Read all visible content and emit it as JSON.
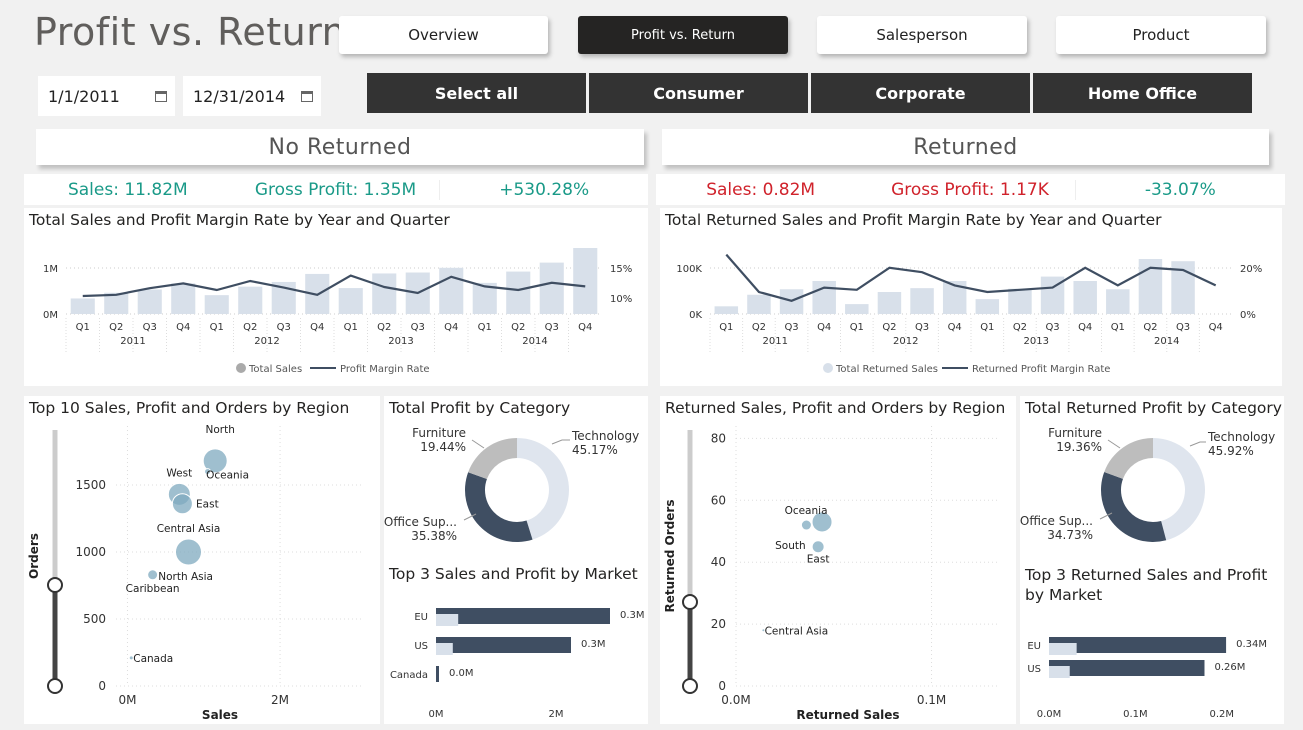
{
  "page_title": "Profit vs. Return",
  "nav": [
    "Overview",
    "Profit vs. Return",
    "Salesperson",
    "Product"
  ],
  "dates": {
    "start": "1/1/2011",
    "end": "12/31/2014"
  },
  "segments": [
    "Select all",
    "Consumer",
    "Corporate",
    "Home Office"
  ],
  "left": {
    "header": "No Returned",
    "kpi": {
      "sales": "Sales: 11.82M",
      "profit": "Gross Profit: 1.35M",
      "change": "+530.28%"
    },
    "combo_title": "Total Sales and Profit Margin Rate by Year and Quarter",
    "scatter_title": "Top 10 Sales, Profit and Orders by Region",
    "donut_title": "Total Profit by Category",
    "bar_title": "Top 3 Sales and Profit by Market"
  },
  "right": {
    "header": "Returned",
    "kpi": {
      "sales": "Sales: 0.82M",
      "profit": "Gross Profit: 1.17K",
      "change": "-33.07%"
    },
    "combo_title": "Total Returned Sales and Profit Margin Rate by Year and Quarter",
    "scatter_title": "Returned Sales, Profit and Orders by Region",
    "donut_title": "Total Returned Profit by Category",
    "bar_title": "Top 3 Returned Sales and Profit by Market"
  },
  "colors": {
    "green": "#1a9a88",
    "red": "#d0222b",
    "bar_light": "#d8e0ea",
    "line_dark": "#3f4e62",
    "bubble": "#7fa9bf",
    "grey_slice": "#bdbdbd"
  },
  "chart_data": [
    {
      "type": "bar",
      "id": "combo_left",
      "quarters": [
        "Q1",
        "Q2",
        "Q3",
        "Q4",
        "Q1",
        "Q2",
        "Q3",
        "Q4",
        "Q1",
        "Q2",
        "Q3",
        "Q4",
        "Q1",
        "Q2",
        "Q3",
        "Q4"
      ],
      "years": [
        "2011",
        "2012",
        "2013",
        "2014"
      ],
      "y_ticks": [
        "1M",
        "0M"
      ],
      "y2_ticks": [
        "15%",
        "10%"
      ],
      "series": [
        {
          "name": "Total Sales",
          "values": [
            0.33,
            0.45,
            0.52,
            0.65,
            0.4,
            0.58,
            0.68,
            0.85,
            0.55,
            0.86,
            0.88,
            0.98,
            0.66,
            0.9,
            1.09,
            1.4
          ]
        },
        {
          "name": "Profit Margin Rate",
          "values": [
            10.0,
            10.2,
            11.3,
            12.1,
            11.0,
            12.5,
            11.4,
            10.2,
            13.4,
            11.5,
            10.5,
            13.2,
            11.6,
            11.0,
            12.2,
            11.6
          ]
        }
      ],
      "ylim": [
        0,
        1.4
      ],
      "y2lim": [
        7,
        18
      ]
    },
    {
      "type": "bar",
      "id": "combo_right",
      "quarters": [
        "Q1",
        "Q2",
        "Q3",
        "Q4",
        "Q1",
        "Q2",
        "Q3",
        "Q4",
        "Q1",
        "Q2",
        "Q3",
        "Q4",
        "Q1",
        "Q2",
        "Q3",
        "Q4"
      ],
      "years": [
        "2011",
        "2012",
        "2013",
        "2014"
      ],
      "y_ticks": [
        "100K",
        "0K"
      ],
      "y2_ticks": [
        "20%",
        "0%"
      ],
      "series": [
        {
          "name": "Total Returned Sales",
          "values": [
            14,
            35,
            45,
            60,
            18,
            40,
            47,
            60,
            27,
            46,
            68,
            60,
            45,
            100,
            96
          ]
        },
        {
          "name": "Returned Profit Margin Rate",
          "values": [
            27,
            10,
            6,
            12,
            11,
            21,
            19,
            13,
            10,
            11,
            12,
            21,
            13,
            21,
            20,
            13
          ]
        }
      ],
      "ylim": [
        0,
        120
      ],
      "y2lim": [
        0,
        30
      ]
    },
    {
      "type": "scatter",
      "id": "scatter_left",
      "xlabel": "Sales",
      "ylabel": "Orders",
      "x_ticks": [
        "0M",
        "2M"
      ],
      "y_ticks": [
        "0",
        "500",
        "1000",
        "1500"
      ],
      "points": [
        {
          "label": "North",
          "x": 1.15,
          "y": 1680,
          "r": 12
        },
        {
          "label": "West",
          "x": 0.68,
          "y": 1430,
          "r": 11
        },
        {
          "label": "Oceania",
          "x": 1.05,
          "y": 1600,
          "r": 3
        },
        {
          "label": "East",
          "x": 0.72,
          "y": 1360,
          "r": 10
        },
        {
          "label": "Central Asia",
          "x": 0.8,
          "y": 1000,
          "r": 13
        },
        {
          "label": "North Asia",
          "x": 0.33,
          "y": 830,
          "r": 5
        },
        {
          "label": "Caribbean",
          "x": 0.33,
          "y": 830,
          "r": 0
        },
        {
          "label": "Canada",
          "x": 0.05,
          "y": 210,
          "r": 2
        }
      ]
    },
    {
      "type": "scatter",
      "id": "scatter_right",
      "xlabel": "Returned Sales",
      "ylabel": "Returned Orders",
      "x_ticks": [
        "0.0M",
        "0.1M"
      ],
      "y_ticks": [
        "0",
        "20",
        "40",
        "60",
        "80"
      ],
      "points": [
        {
          "label": "Oceania",
          "x": 0.044,
          "y": 53,
          "r": 10
        },
        {
          "label": "South",
          "x": 0.036,
          "y": 52,
          "r": 5
        },
        {
          "label": "East",
          "x": 0.042,
          "y": 45,
          "r": 6
        },
        {
          "label": "Central Asia",
          "x": 0.014,
          "y": 18,
          "r": 1.5
        }
      ]
    },
    {
      "type": "pie",
      "id": "donut_left",
      "slices": [
        {
          "label": "Technology",
          "pct": "45.17%",
          "value": 45.17
        },
        {
          "label": "Office Sup...",
          "pct": "35.38%",
          "value": 35.38
        },
        {
          "label": "Furniture",
          "pct": "19.44%",
          "value": 19.44
        }
      ]
    },
    {
      "type": "pie",
      "id": "donut_right",
      "slices": [
        {
          "label": "Technology",
          "pct": "45.92%",
          "value": 45.92
        },
        {
          "label": "Office Sup...",
          "pct": "34.73%",
          "value": 34.73
        },
        {
          "label": "Furniture",
          "pct": "19.36%",
          "value": 19.36
        }
      ]
    },
    {
      "type": "bar",
      "id": "market_left",
      "categories": [
        "EU",
        "US",
        "Canada"
      ],
      "x_ticks": [
        "0M",
        "2M"
      ],
      "series": [
        {
          "name": "Sales",
          "values": [
            2.9,
            2.25,
            0.03
          ]
        },
        {
          "name": "Profit",
          "values": [
            0.37,
            0.28,
            0.0
          ]
        }
      ],
      "labels": [
        "0.3M",
        "0.3M",
        "0.0M"
      ],
      "xlim": [
        0,
        3.0
      ]
    },
    {
      "type": "bar",
      "id": "market_right",
      "categories": [
        "EU",
        "US"
      ],
      "x_ticks": [
        "0.0M",
        "0.1M",
        "0.2M"
      ],
      "series": [
        {
          "name": "Sales",
          "values": [
            0.205,
            0.18
          ]
        },
        {
          "name": "Profit",
          "values": [
            0.032,
            0.024
          ]
        }
      ],
      "labels": [
        "0.34M",
        "0.26M"
      ],
      "xlim": [
        0,
        0.235
      ]
    }
  ]
}
